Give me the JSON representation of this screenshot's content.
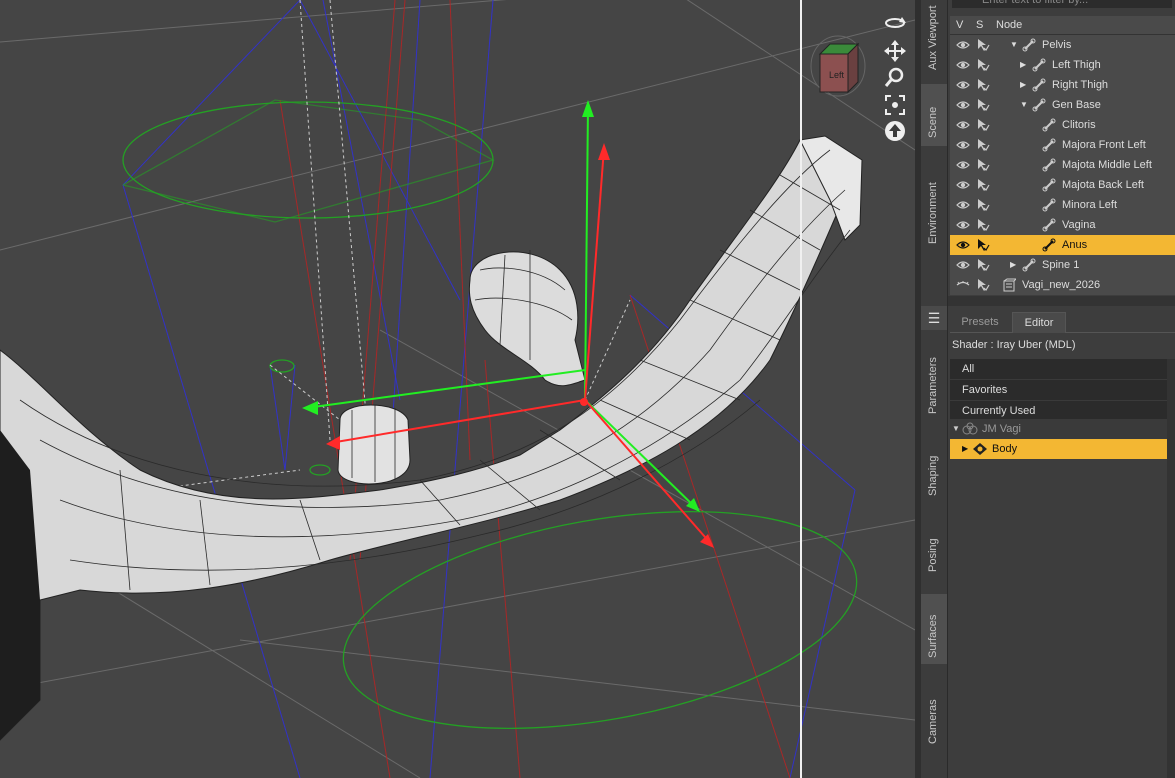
{
  "viewport": {
    "cube_label": "Left"
  },
  "side_tabs": [
    {
      "label": "Aux Viewport",
      "name": "tab-aux-viewport"
    },
    {
      "label": "Scene",
      "name": "tab-scene"
    },
    {
      "label": "Environment",
      "name": "tab-environment"
    },
    {
      "label": "Parameters",
      "name": "tab-parameters"
    },
    {
      "label": "Shaping",
      "name": "tab-shaping"
    },
    {
      "label": "Posing",
      "name": "tab-posing"
    },
    {
      "label": "Surfaces",
      "name": "tab-surfaces"
    },
    {
      "label": "Cameras",
      "name": "tab-cameras"
    }
  ],
  "scene": {
    "filter_placeholder": "Enter text to filter by...",
    "header": {
      "v": "V",
      "s": "S",
      "node": "Node"
    },
    "nodes": [
      {
        "label": "Pelvis",
        "depth": 3,
        "expander": "▼"
      },
      {
        "label": "Left Thigh",
        "depth": 4,
        "expander": "▶"
      },
      {
        "label": "Right Thigh",
        "depth": 4,
        "expander": "▶"
      },
      {
        "label": "Gen Base",
        "depth": 4,
        "expander": "▼"
      },
      {
        "label": "Clitoris",
        "depth": 5,
        "expander": ""
      },
      {
        "label": "Majora Front Left",
        "depth": 5,
        "expander": ""
      },
      {
        "label": "Majota Middle Left",
        "depth": 5,
        "expander": ""
      },
      {
        "label": "Majota Back Left",
        "depth": 5,
        "expander": ""
      },
      {
        "label": "Minora Left",
        "depth": 5,
        "expander": ""
      },
      {
        "label": "Vagina",
        "depth": 5,
        "expander": ""
      },
      {
        "label": "Anus",
        "depth": 5,
        "expander": "",
        "selected": true
      },
      {
        "label": "Spine 1",
        "depth": 3,
        "expander": "▶"
      },
      {
        "label": "Vagi_new_2026",
        "depth": 1,
        "expander": "",
        "icon": "figure"
      }
    ]
  },
  "surfaces": {
    "tabs": {
      "presets": "Presets",
      "editor": "Editor"
    },
    "shader": "Shader :  Iray Uber (MDL)",
    "filters": [
      "All",
      "Favorites",
      "Currently Used"
    ],
    "group": "JM Vagi",
    "selected_surface": "Body"
  },
  "colors": {
    "selection": "#f3b733",
    "viewport_bg": "#454545",
    "axis_x": "#ff2a2a",
    "axis_y": "#22ee22",
    "bone_blue": "#3232c8",
    "bone_green": "#24a024"
  }
}
